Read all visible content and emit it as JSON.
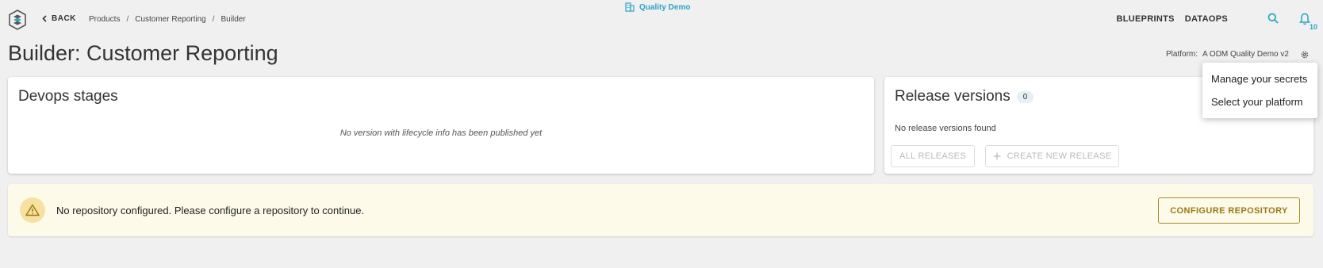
{
  "header": {
    "back_label": "BACK",
    "breadcrumb": [
      "Products",
      "Customer Reporting",
      "Builder"
    ],
    "breadcrumb_separator": "/",
    "workspace": "Quality Demo",
    "nav": [
      "BLUEPRINTS",
      "DATAOPS"
    ],
    "notification_count": "10"
  },
  "page": {
    "title": "Builder: Customer Reporting",
    "platform_label": "Platform:",
    "platform_value": "A ODM Quality Demo v2"
  },
  "devops": {
    "title": "Devops stages",
    "empty_message": "No version with lifecycle info has been published yet"
  },
  "releases": {
    "title": "Release versions",
    "count": "0",
    "empty_message": "No release versions found",
    "all_releases_label": "ALL RELEASES",
    "create_label": "CREATE NEW RELEASE"
  },
  "menu": {
    "items": [
      "Manage your secrets",
      "Select your platform"
    ]
  },
  "warning": {
    "message": "No repository configured. Please configure a repository to continue.",
    "action_label": "CONFIGURE REPOSITORY"
  },
  "colors": {
    "accent": "#2ba4c4",
    "warning_bg": "#fdfaea",
    "warning_action": "#9a7a14"
  }
}
